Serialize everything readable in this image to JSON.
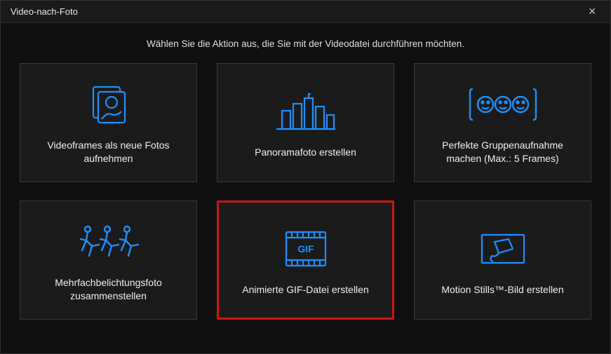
{
  "window": {
    "title": "Video-nach-Foto",
    "close_label": "✕"
  },
  "instruction": "Wählen Sie die Aktion aus, die Sie mit der Videodatei durchführen möchten.",
  "tiles": [
    {
      "label": "Videoframes als neue Fotos aufnehmen"
    },
    {
      "label": "Panoramafoto erstellen"
    },
    {
      "label": "Perfekte Gruppenaufnahme machen (Max.: 5 Frames)"
    },
    {
      "label": "Mehrfachbelichtungsfoto zusammenstellen"
    },
    {
      "label": "Animierte GIF-Datei erstellen"
    },
    {
      "label": "Motion Stills™-Bild erstellen"
    }
  ],
  "accent_color": "#1e90ff"
}
